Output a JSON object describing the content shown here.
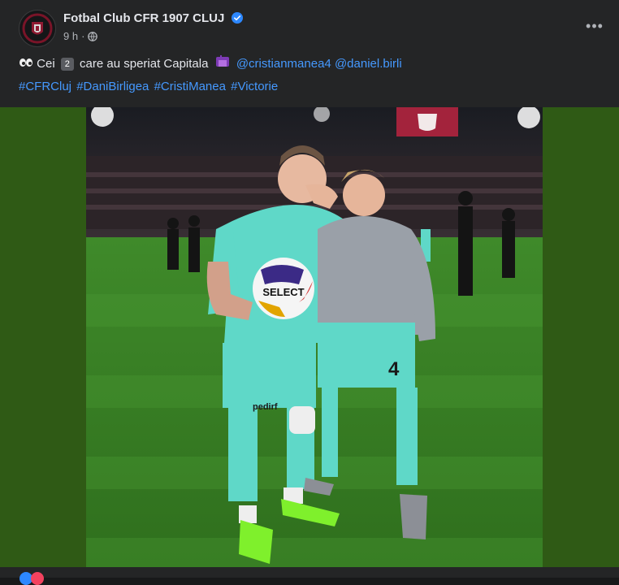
{
  "post": {
    "page_name": "Fotbal Club CFR 1907 CLUJ",
    "time": "9 h",
    "separator": "·",
    "more_label": "•••",
    "caption": {
      "text_before": "Cei",
      "number": "2",
      "text_after": "care au speriat Capitala",
      "mention_1": "@cristianmanea4",
      "mention_2": "@daniel.birli"
    },
    "hashtags": [
      "#CFRCluj",
      "#DaniBirligea",
      "#CristiManea",
      "#Victorie"
    ],
    "photo": {
      "ball_brand": "SELECT",
      "sponsor": "pedirf",
      "shirt_number": "4"
    }
  },
  "colors": {
    "background": "#242526",
    "link": "#4599ff",
    "media_border": "#2f5a15",
    "kit": "#5fd8c8",
    "verified": "#2d88ff"
  },
  "icons": [
    "verified-badge-icon",
    "globe-icon",
    "more-options-icon",
    "eyes-emoji-icon",
    "stadium-emoji-icon"
  ]
}
